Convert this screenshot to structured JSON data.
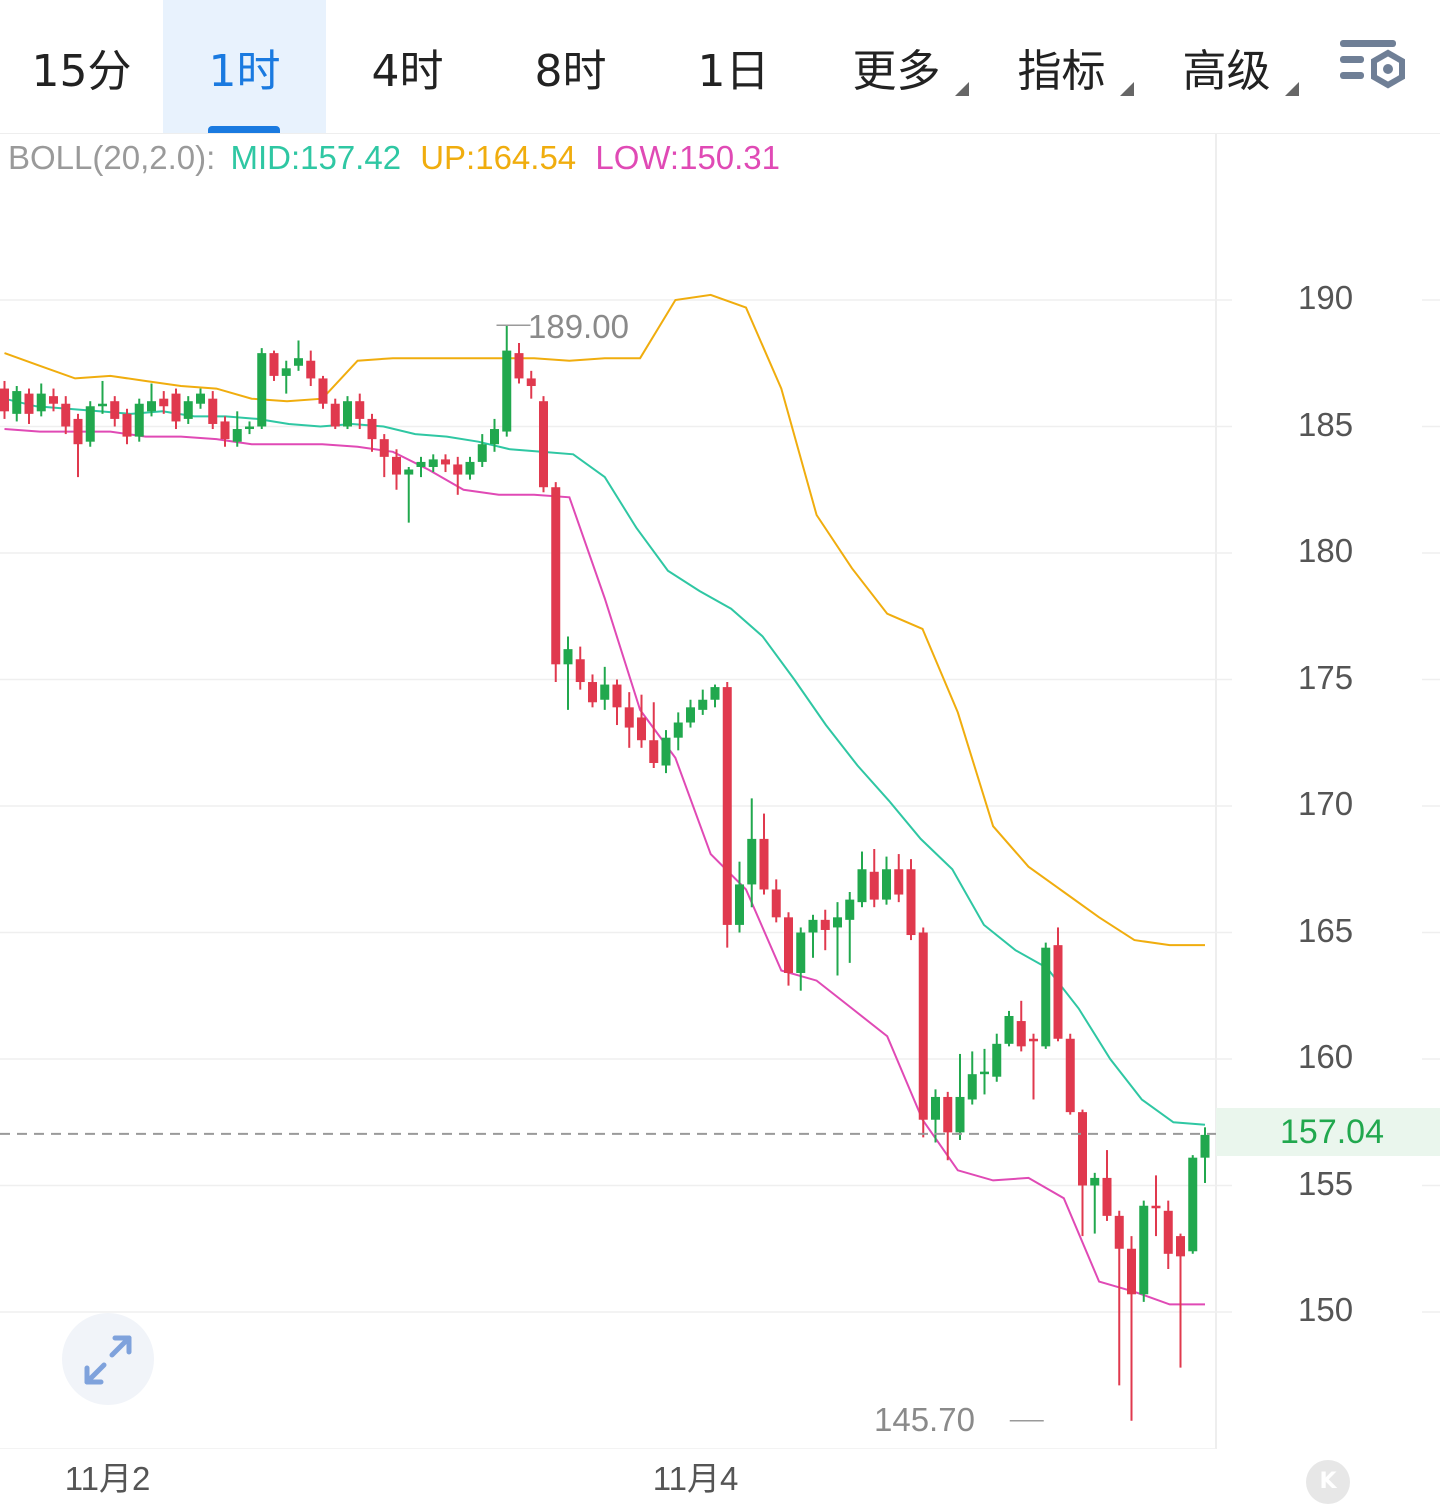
{
  "tabs": [
    {
      "label": "15分",
      "active": false,
      "dropdown": false
    },
    {
      "label": "1时",
      "active": true,
      "dropdown": false
    },
    {
      "label": "4时",
      "active": false,
      "dropdown": false
    },
    {
      "label": "8时",
      "active": false,
      "dropdown": false
    },
    {
      "label": "1日",
      "active": false,
      "dropdown": false
    },
    {
      "label": "更多",
      "active": false,
      "dropdown": true
    },
    {
      "label": "指标",
      "active": false,
      "dropdown": true
    },
    {
      "label": "高级",
      "active": false,
      "dropdown": true
    }
  ],
  "icons": {
    "settings": "chart-settings-icon",
    "expand": "expand-arrows-icon",
    "badge": "k-badge-icon"
  },
  "indicator": {
    "name": "BOLL(20,2.0):",
    "mid": "MID:157.42",
    "up": "UP:164.54",
    "low": "LOW:150.31"
  },
  "colors": {
    "up": "#21a84e",
    "down": "#e0394e",
    "mid": "#2fc7a3",
    "upper": "#f0ad0e",
    "lower": "#e04ab5",
    "accent": "#1a7ae0"
  },
  "current_price": "157.04",
  "high_annotation": "189.00",
  "low_annotation": "145.70",
  "badge_letter": "K",
  "chart_data": {
    "type": "candlestick",
    "interval": "1时",
    "yticks": [
      "190",
      "185",
      "180",
      "175",
      "170",
      "165",
      "160",
      "155",
      "150"
    ],
    "ylim": [
      144.7,
      195
    ],
    "xticks": [
      {
        "label": "11月2",
        "index": 9
      },
      {
        "label": "11月4",
        "index": 57
      }
    ],
    "current": 157.04,
    "high": {
      "value": 189.0,
      "index": 40
    },
    "low": {
      "value": 145.7,
      "index": 85
    },
    "candles": [
      [
        186.5,
        185.6,
        186.8,
        185.3
      ],
      [
        185.5,
        186.4,
        186.6,
        185.2
      ],
      [
        186.3,
        185.5,
        186.5,
        185.1
      ],
      [
        185.6,
        186.3,
        186.7,
        185.4
      ],
      [
        186.2,
        185.9,
        186.5,
        185.6
      ],
      [
        185.9,
        185.0,
        186.2,
        184.7
      ],
      [
        185.3,
        184.3,
        185.5,
        183.0
      ],
      [
        184.4,
        185.8,
        186.0,
        184.2
      ],
      [
        185.8,
        185.9,
        186.8,
        185.5
      ],
      [
        186.0,
        185.3,
        186.2,
        185.0
      ],
      [
        185.5,
        184.6,
        185.7,
        184.3
      ],
      [
        184.6,
        185.9,
        186.1,
        184.4
      ],
      [
        185.6,
        186.0,
        186.7,
        185.4
      ],
      [
        186.1,
        185.8,
        186.4,
        185.5
      ],
      [
        186.3,
        185.2,
        186.5,
        184.9
      ],
      [
        185.3,
        186.0,
        186.2,
        185.1
      ],
      [
        185.9,
        186.3,
        186.5,
        185.7
      ],
      [
        186.1,
        185.1,
        186.4,
        184.9
      ],
      [
        185.2,
        184.5,
        185.4,
        184.2
      ],
      [
        184.4,
        184.9,
        185.6,
        184.2
      ],
      [
        184.9,
        185.0,
        185.2,
        184.7
      ],
      [
        185.0,
        187.9,
        188.1,
        184.9
      ],
      [
        187.9,
        187.0,
        188.0,
        186.8
      ],
      [
        187.0,
        187.3,
        187.6,
        186.3
      ],
      [
        187.4,
        187.7,
        188.4,
        187.2
      ],
      [
        187.6,
        186.9,
        188.0,
        186.6
      ],
      [
        186.9,
        185.9,
        187.0,
        185.7
      ],
      [
        185.9,
        185.0,
        186.1,
        184.9
      ],
      [
        185.0,
        186.0,
        186.2,
        184.9
      ],
      [
        186.0,
        185.3,
        186.3,
        184.9
      ],
      [
        185.3,
        184.5,
        185.5,
        184.0
      ],
      [
        184.5,
        183.8,
        184.7,
        183.0
      ],
      [
        183.8,
        183.1,
        184.1,
        182.5
      ],
      [
        183.1,
        183.3,
        183.4,
        181.2
      ],
      [
        183.4,
        183.6,
        183.8,
        183.0
      ],
      [
        183.4,
        183.7,
        183.9,
        183.2
      ],
      [
        183.7,
        183.5,
        183.9,
        183.2
      ],
      [
        183.5,
        183.1,
        183.8,
        182.3
      ],
      [
        183.1,
        183.6,
        183.8,
        182.9
      ],
      [
        183.6,
        184.3,
        184.7,
        183.4
      ],
      [
        184.3,
        184.9,
        185.3,
        184.0
      ],
      [
        184.8,
        188.0,
        189.0,
        184.6
      ],
      [
        187.9,
        186.9,
        188.3,
        186.7
      ],
      [
        186.9,
        186.6,
        187.2,
        186.1
      ],
      [
        186.0,
        182.6,
        186.2,
        182.4
      ],
      [
        182.6,
        175.6,
        182.8,
        174.9
      ],
      [
        175.6,
        176.2,
        176.7,
        173.8
      ],
      [
        175.8,
        174.9,
        176.3,
        174.6
      ],
      [
        174.9,
        174.1,
        175.2,
        173.9
      ],
      [
        174.2,
        174.8,
        175.5,
        173.8
      ],
      [
        174.8,
        173.9,
        175.0,
        173.2
      ],
      [
        173.9,
        173.1,
        174.5,
        172.3
      ],
      [
        173.5,
        172.6,
        174.4,
        172.3
      ],
      [
        172.6,
        171.7,
        174.1,
        171.5
      ],
      [
        171.6,
        172.7,
        173.0,
        171.3
      ],
      [
        172.7,
        173.3,
        173.7,
        172.2
      ],
      [
        173.3,
        173.9,
        174.2,
        173.1
      ],
      [
        173.8,
        174.2,
        174.6,
        173.6
      ],
      [
        174.2,
        174.7,
        174.8,
        173.9
      ],
      [
        174.7,
        165.3,
        174.9,
        164.4
      ],
      [
        165.3,
        166.9,
        167.8,
        165.0
      ],
      [
        166.9,
        168.7,
        170.3,
        166.0
      ],
      [
        168.7,
        166.7,
        169.7,
        166.5
      ],
      [
        166.7,
        165.6,
        167.1,
        165.4
      ],
      [
        165.6,
        163.4,
        165.8,
        162.9
      ],
      [
        163.4,
        165.0,
        165.2,
        162.7
      ],
      [
        165.0,
        165.5,
        165.7,
        164.0
      ],
      [
        165.5,
        165.1,
        165.9,
        164.3
      ],
      [
        165.2,
        165.6,
        166.2,
        163.3
      ],
      [
        165.5,
        166.3,
        166.6,
        163.8
      ],
      [
        166.2,
        167.5,
        168.2,
        166.0
      ],
      [
        167.4,
        166.3,
        168.3,
        166.0
      ],
      [
        166.3,
        167.5,
        168.0,
        166.1
      ],
      [
        167.5,
        166.5,
        168.1,
        166.2
      ],
      [
        167.5,
        164.9,
        167.9,
        164.7
      ],
      [
        165.0,
        157.6,
        165.2,
        156.9
      ],
      [
        157.6,
        158.5,
        158.8,
        156.7
      ],
      [
        158.5,
        157.1,
        158.7,
        156.0
      ],
      [
        157.1,
        158.5,
        160.2,
        156.8
      ],
      [
        158.4,
        159.4,
        160.3,
        158.2
      ],
      [
        159.4,
        159.5,
        160.4,
        158.6
      ],
      [
        159.3,
        160.6,
        161.0,
        159.1
      ],
      [
        160.6,
        161.7,
        161.9,
        160.5
      ],
      [
        161.5,
        160.5,
        162.3,
        160.3
      ],
      [
        160.8,
        160.7,
        161.0,
        158.4
      ],
      [
        160.5,
        164.4,
        164.6,
        160.4
      ],
      [
        164.5,
        160.8,
        165.2,
        160.7
      ],
      [
        160.8,
        157.9,
        161.0,
        157.8
      ],
      [
        157.9,
        155.0,
        158.0,
        153.0
      ],
      [
        155.0,
        155.3,
        155.5,
        153.1
      ],
      [
        155.3,
        153.8,
        156.4,
        153.6
      ],
      [
        153.8,
        152.5,
        154.0,
        147.1
      ],
      [
        152.5,
        150.7,
        153.0,
        145.7
      ],
      [
        150.7,
        154.2,
        154.4,
        150.4
      ],
      [
        154.2,
        154.1,
        155.4,
        153.0
      ],
      [
        154.0,
        152.3,
        154.4,
        151.7
      ],
      [
        153.0,
        152.2,
        153.1,
        147.8
      ],
      [
        152.4,
        156.1,
        156.2,
        152.3
      ],
      [
        156.1,
        157.0,
        157.3,
        155.1
      ]
    ],
    "mid_line": [
      186.1,
      185.8,
      185.7,
      185.6,
      185.5,
      185.6,
      185.4,
      185.4,
      185.3,
      185.1,
      185.0,
      185.1,
      185.0,
      184.7,
      184.6,
      184.4,
      184.1,
      184.0,
      183.9,
      183.0,
      181.0,
      179.3,
      178.5,
      177.8,
      176.7,
      175.0,
      173.2,
      171.6,
      170.2,
      168.7,
      167.5,
      165.3,
      164.3,
      163.6,
      162.0,
      160.0,
      158.4,
      157.5,
      157.4
    ],
    "upper_line": [
      187.9,
      187.4,
      186.9,
      187.0,
      186.8,
      186.6,
      186.5,
      186.1,
      186.0,
      186.1,
      187.6,
      187.7,
      187.7,
      187.7,
      187.7,
      187.7,
      187.6,
      187.7,
      187.7,
      190.0,
      190.2,
      189.7,
      186.5,
      181.5,
      179.4,
      177.6,
      177.0,
      173.7,
      169.2,
      167.6,
      166.6,
      165.6,
      164.7,
      164.5,
      164.5
    ],
    "lower_line": [
      184.9,
      184.8,
      184.8,
      184.8,
      184.6,
      184.6,
      184.5,
      184.3,
      184.3,
      184.3,
      184.2,
      184.0,
      183.3,
      182.5,
      182.3,
      182.3,
      182.2,
      178.2,
      173.8,
      171.9,
      168.1,
      166.7,
      163.5,
      163.1,
      162.0,
      160.9,
      157.6,
      155.6,
      155.2,
      155.3,
      154.5,
      151.2,
      150.8,
      150.3,
      150.3
    ]
  }
}
